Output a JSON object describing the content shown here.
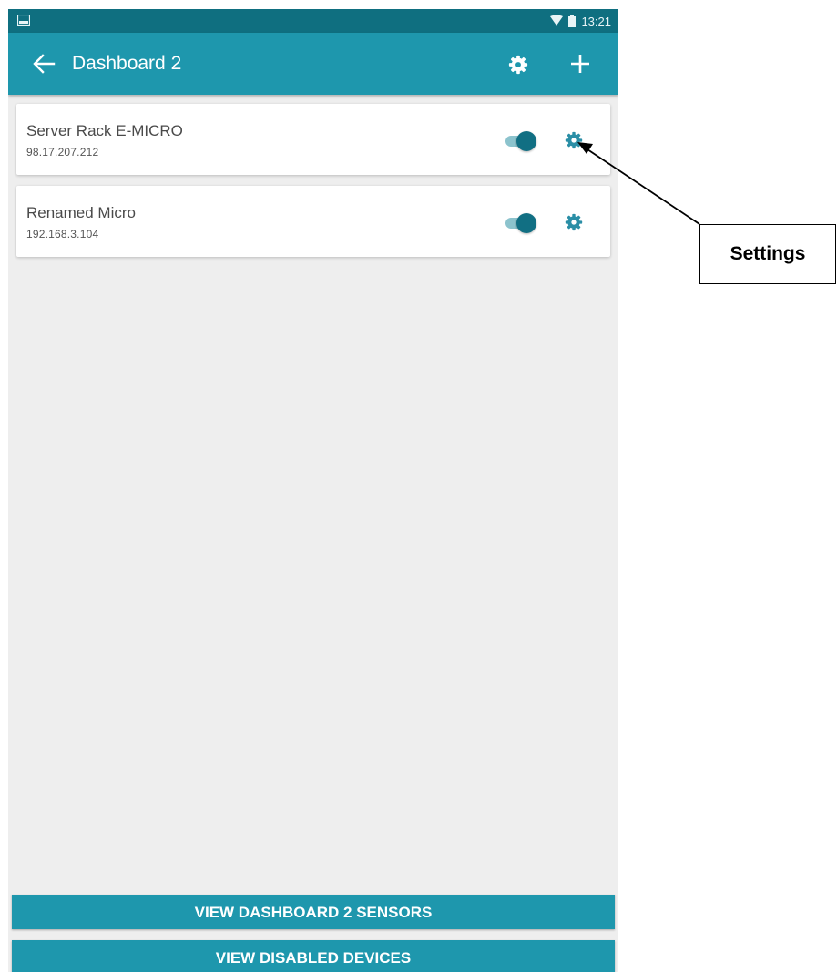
{
  "status_bar": {
    "time": "13:21",
    "icons": [
      "image-icon",
      "wifi-icon",
      "battery-icon"
    ]
  },
  "app_bar": {
    "title": "Dashboard 2",
    "icons": [
      "back-arrow-icon",
      "gear-icon",
      "plus-icon"
    ]
  },
  "devices": [
    {
      "name": "Server Rack E-MICRO",
      "ip": "98.17.207.212",
      "enabled": true
    },
    {
      "name": "Renamed Micro",
      "ip": "192.168.3.104",
      "enabled": true
    }
  ],
  "buttons": {
    "view_sensors": "VIEW DASHBOARD 2 SENSORS",
    "view_disabled": "VIEW DISABLED DEVICES"
  },
  "callout": {
    "label": "Settings"
  },
  "colors": {
    "app_bar": "#1e97ad",
    "status_bar": "#0f6f80",
    "accent": "#116f83",
    "background": "#eeeeee"
  }
}
